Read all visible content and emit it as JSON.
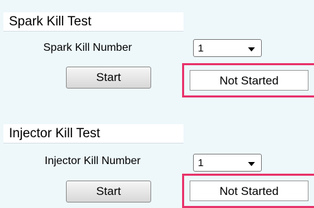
{
  "spark": {
    "title": "Spark Kill Test",
    "number_label": "Spark Kill Number",
    "number_value": "1",
    "start_label": "Start",
    "status": "Not Started"
  },
  "injector": {
    "title": "Injector Kill Test",
    "number_label": "Injector Kill Number",
    "number_value": "1",
    "start_label": "Start",
    "status": "Not Started"
  },
  "colors": {
    "background": "#eef8fb",
    "highlight": "#e8336b"
  },
  "icons": {
    "dropdown": "chevron-down-icon"
  }
}
